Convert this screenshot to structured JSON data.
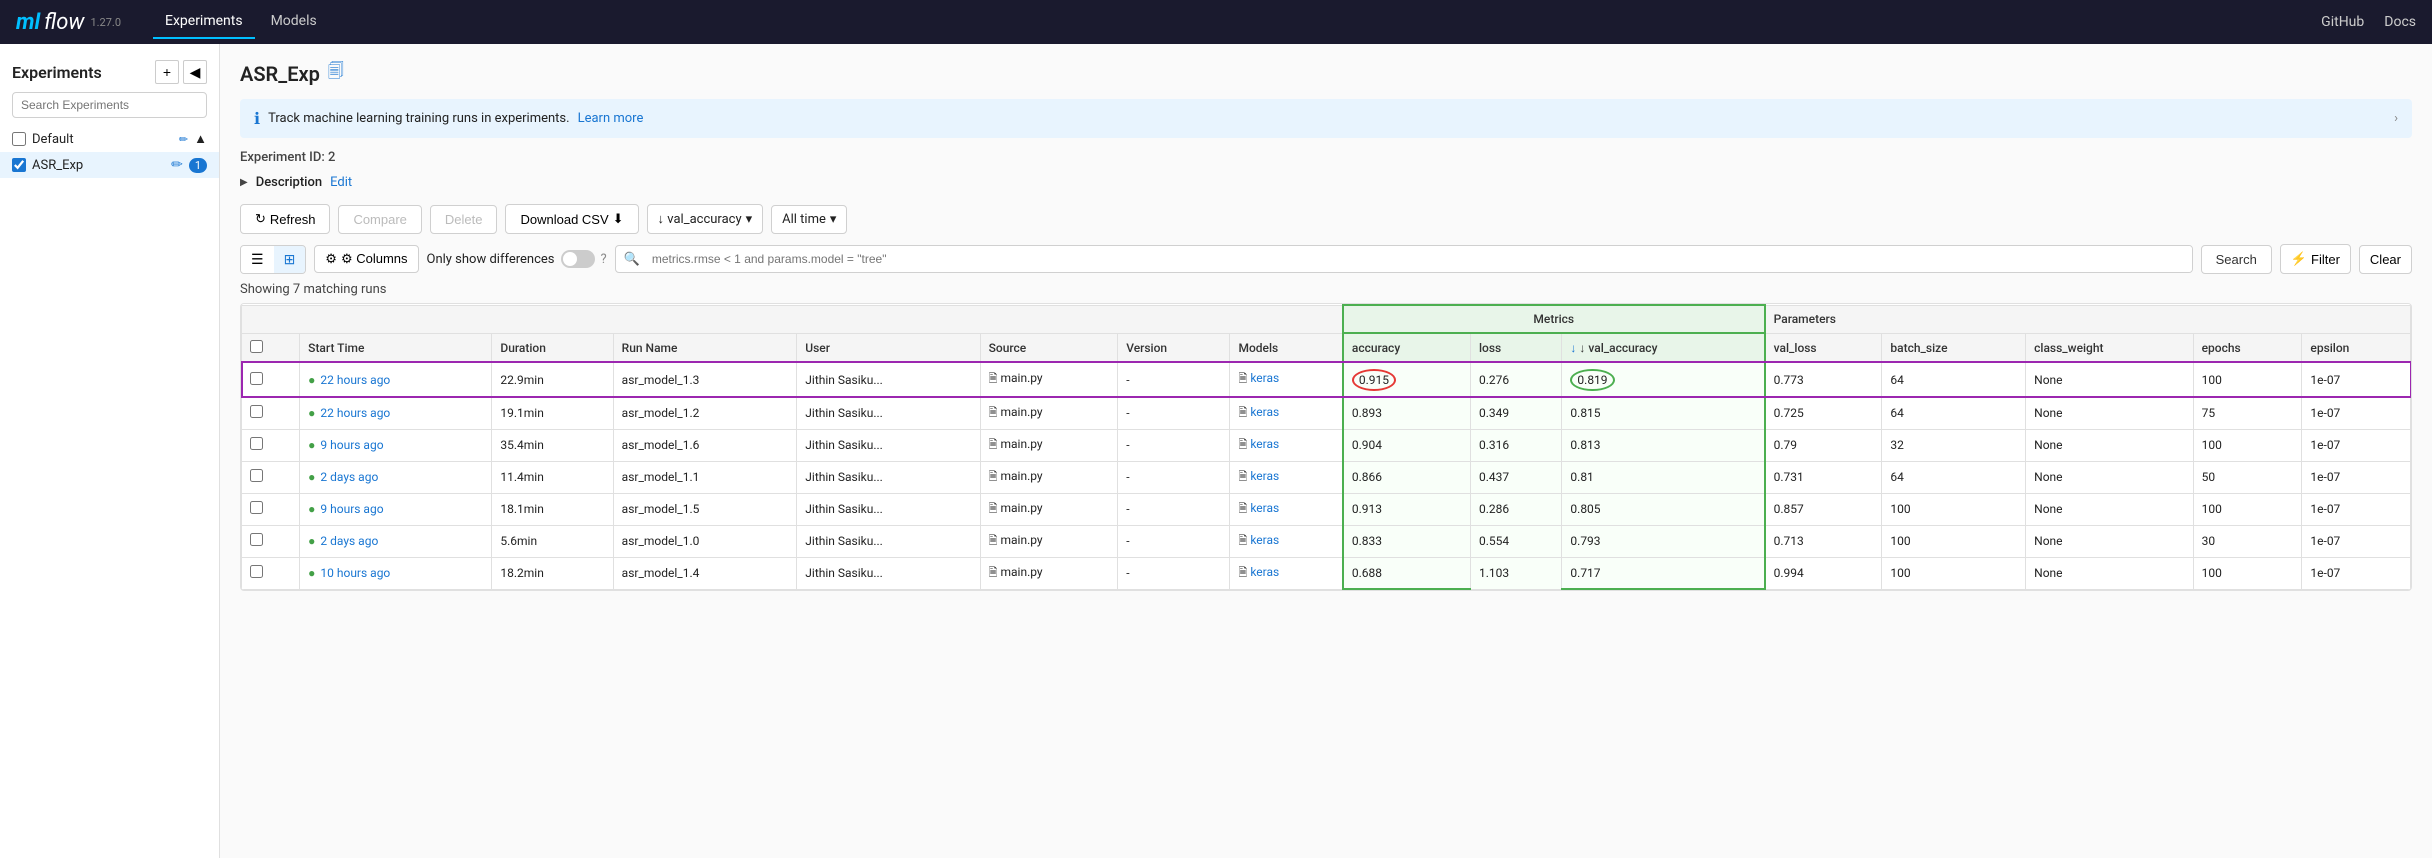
{
  "nav": {
    "logo_ml": "ml",
    "logo_flow": "flow",
    "version": "1.27.0",
    "items": [
      "Experiments",
      "Models"
    ],
    "active_item": "Experiments",
    "right_links": [
      "GitHub",
      "Docs"
    ]
  },
  "sidebar": {
    "title": "Experiments",
    "add_btn": "+",
    "collapse_btn": "◀",
    "search_placeholder": "Search Experiments",
    "items": [
      {
        "label": "Default",
        "checked": false,
        "active": false
      },
      {
        "label": "ASR_Exp",
        "checked": true,
        "active": true
      }
    ]
  },
  "main": {
    "exp_title": "ASR_Exp",
    "exp_id_label": "Experiment ID:",
    "exp_id": "2",
    "info_banner": "Track machine learning training runs in experiments.",
    "info_link_text": "Learn more",
    "description_label": "Description",
    "description_edit": "Edit",
    "toolbar": {
      "refresh": "Refresh",
      "compare": "Compare",
      "delete": "Delete",
      "download_csv": "Download CSV",
      "sort_by": "↓ val_accuracy",
      "time_filter": "All time"
    },
    "filter_bar": {
      "columns_btn": "⚙ Columns",
      "only_show_diff": "Only show differences",
      "search_placeholder": "metrics.rmse < 1 and params.model = \"tree\"",
      "search_btn": "Search",
      "filter_btn": "Filter",
      "clear_btn": "Clear"
    },
    "showing_count": "Showing 7 matching runs",
    "metrics_label": "Metrics",
    "params_label": "Parameters",
    "table": {
      "columns": [
        "",
        "Start Time",
        "Duration",
        "Run Name",
        "User",
        "Source",
        "Version",
        "Models",
        "accuracy",
        "loss",
        "↓ val_accuracy",
        "val_loss",
        "batch_size",
        "class_weight",
        "epochs",
        "epsilon"
      ],
      "rows": [
        {
          "start_time": "22 hours ago",
          "duration": "22.9min",
          "run_name": "asr_model_1.3",
          "user": "Jithin Sasiku...",
          "source": "main.py",
          "version": "-",
          "model": "keras",
          "accuracy": "0.915",
          "loss": "0.276",
          "val_accuracy": "0.819",
          "val_loss": "0.773",
          "batch_size": "64",
          "class_weight": "None",
          "epochs": "100",
          "epsilon": "1e-07",
          "highlight_row": true
        },
        {
          "start_time": "22 hours ago",
          "duration": "19.1min",
          "run_name": "asr_model_1.2",
          "user": "Jithin Sasiku...",
          "source": "main.py",
          "version": "-",
          "model": "keras",
          "accuracy": "0.893",
          "loss": "0.349",
          "val_accuracy": "0.815",
          "val_loss": "0.725",
          "batch_size": "64",
          "class_weight": "None",
          "epochs": "75",
          "epsilon": "1e-07",
          "highlight_row": false
        },
        {
          "start_time": "9 hours ago",
          "duration": "35.4min",
          "run_name": "asr_model_1.6",
          "user": "Jithin Sasiku...",
          "source": "main.py",
          "version": "-",
          "model": "keras",
          "accuracy": "0.904",
          "loss": "0.316",
          "val_accuracy": "0.813",
          "val_loss": "0.79",
          "batch_size": "32",
          "class_weight": "None",
          "epochs": "100",
          "epsilon": "1e-07",
          "highlight_row": false
        },
        {
          "start_time": "2 days ago",
          "duration": "11.4min",
          "run_name": "asr_model_1.1",
          "user": "Jithin Sasiku...",
          "source": "main.py",
          "version": "-",
          "model": "keras",
          "accuracy": "0.866",
          "loss": "0.437",
          "val_accuracy": "0.81",
          "val_loss": "0.731",
          "batch_size": "64",
          "class_weight": "None",
          "epochs": "50",
          "epsilon": "1e-07",
          "highlight_row": false
        },
        {
          "start_time": "9 hours ago",
          "duration": "18.1min",
          "run_name": "asr_model_1.5",
          "user": "Jithin Sasiku...",
          "source": "main.py",
          "version": "-",
          "model": "keras",
          "accuracy": "0.913",
          "loss": "0.286",
          "val_accuracy": "0.805",
          "val_loss": "0.857",
          "batch_size": "100",
          "class_weight": "None",
          "epochs": "100",
          "epsilon": "1e-07",
          "highlight_row": false
        },
        {
          "start_time": "2 days ago",
          "duration": "5.6min",
          "run_name": "asr_model_1.0",
          "user": "Jithin Sasiku...",
          "source": "main.py",
          "version": "-",
          "model": "keras",
          "accuracy": "0.833",
          "loss": "0.554",
          "val_accuracy": "0.793",
          "val_loss": "0.713",
          "batch_size": "100",
          "class_weight": "None",
          "epochs": "30",
          "epsilon": "1e-07",
          "highlight_row": false
        },
        {
          "start_time": "10 hours ago",
          "duration": "18.2min",
          "run_name": "asr_model_1.4",
          "user": "Jithin Sasiku...",
          "source": "main.py",
          "version": "-",
          "model": "keras",
          "accuracy": "0.688",
          "loss": "1.103",
          "val_accuracy": "0.717",
          "val_loss": "0.994",
          "batch_size": "100",
          "class_weight": "None",
          "epochs": "100",
          "epsilon": "1e-07",
          "highlight_row": false
        }
      ]
    }
  }
}
